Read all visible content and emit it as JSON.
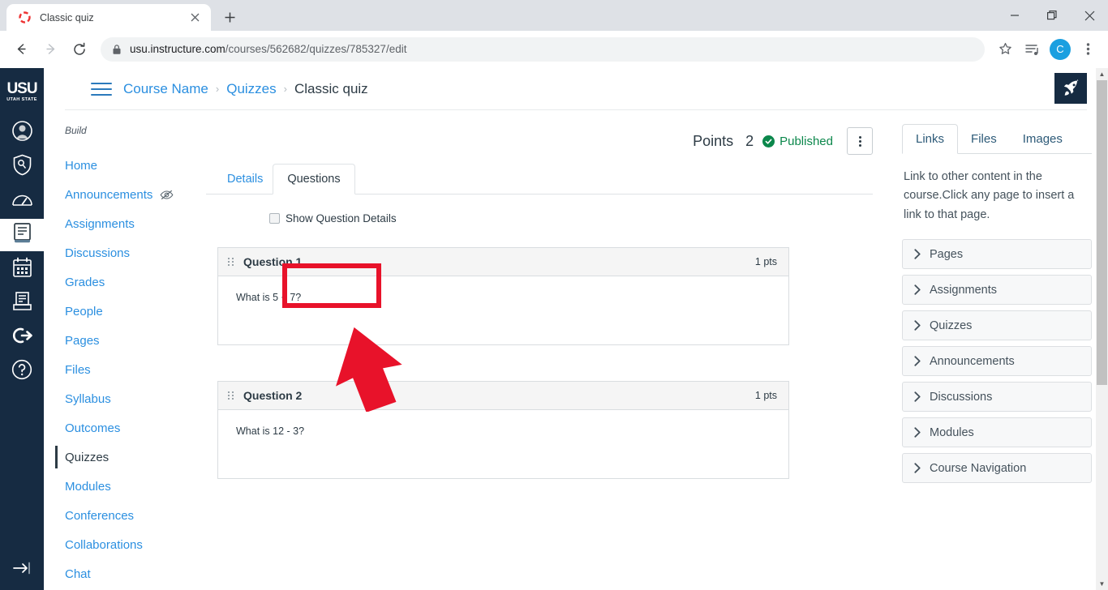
{
  "browser": {
    "tab": {
      "title": "Classic quiz",
      "favicon_icon": "loading-spinner-icon",
      "close_icon": "close-icon"
    },
    "new_tab_icon": "plus-icon",
    "window": {
      "minimize_icon": "minimize-icon",
      "maximize_icon": "restore-icon",
      "close_icon": "close-icon"
    },
    "toolbar": {
      "back_icon": "back-arrow-icon",
      "forward_icon": "forward-arrow-icon",
      "reload_icon": "reload-icon",
      "lock_icon": "lock-icon",
      "url_host": "usu.instructure.com",
      "url_path": "/courses/562682/quizzes/785327/edit",
      "bookmark_icon": "star-icon",
      "readinglist_icon": "reading-list-icon",
      "profile_initial": "C",
      "menu_icon": "kebab-menu-icon"
    }
  },
  "global_nav": {
    "logo": {
      "word": "USU",
      "sub": "UTAH STATE"
    },
    "items": [
      {
        "name": "account",
        "icon": "user-avatar-icon",
        "active": false
      },
      {
        "name": "admin",
        "icon": "shield-key-icon",
        "active": false
      },
      {
        "name": "dashboard",
        "icon": "speedometer-icon",
        "active": false
      },
      {
        "name": "courses",
        "icon": "book-icon",
        "active": true
      },
      {
        "name": "calendar",
        "icon": "calendar-icon",
        "active": false
      },
      {
        "name": "inbox",
        "icon": "inbox-tray-icon",
        "active": false
      },
      {
        "name": "logout",
        "icon": "logout-arrow-icon",
        "active": false
      },
      {
        "name": "help",
        "icon": "question-mark-icon",
        "active": false
      }
    ],
    "collapse_icon": "collapse-arrow-icon"
  },
  "breadcrumb": {
    "menu_icon": "hamburger-icon",
    "items": [
      {
        "label": "Course Name",
        "current": false
      },
      {
        "label": "Quizzes",
        "current": false
      },
      {
        "label": "Classic quiz",
        "current": true
      }
    ],
    "separator": "›"
  },
  "course_nav": {
    "section_label": "Build",
    "items": [
      {
        "label": "Home",
        "active": false,
        "hidden_icon": false
      },
      {
        "label": "Announcements",
        "active": false,
        "hidden_icon": true
      },
      {
        "label": "Assignments",
        "active": false,
        "hidden_icon": false
      },
      {
        "label": "Discussions",
        "active": false,
        "hidden_icon": false
      },
      {
        "label": "Grades",
        "active": false,
        "hidden_icon": false
      },
      {
        "label": "People",
        "active": false,
        "hidden_icon": false
      },
      {
        "label": "Pages",
        "active": false,
        "hidden_icon": false
      },
      {
        "label": "Files",
        "active": false,
        "hidden_icon": false
      },
      {
        "label": "Syllabus",
        "active": false,
        "hidden_icon": false
      },
      {
        "label": "Outcomes",
        "active": false,
        "hidden_icon": false
      },
      {
        "label": "Quizzes",
        "active": true,
        "hidden_icon": false
      },
      {
        "label": "Modules",
        "active": false,
        "hidden_icon": false
      },
      {
        "label": "Conferences",
        "active": false,
        "hidden_icon": false
      },
      {
        "label": "Collaborations",
        "active": false,
        "hidden_icon": false
      },
      {
        "label": "Chat",
        "active": false,
        "hidden_icon": false
      }
    ]
  },
  "quiz": {
    "points_label": "Points",
    "points_value": "2",
    "status_label": "Published",
    "status_icon": "check-circle-icon",
    "status_color": "#0b874b",
    "kebab_icon": "kebab-menu-icon",
    "tabs": [
      {
        "label": "Details",
        "selected": false
      },
      {
        "label": "Questions",
        "selected": true
      }
    ],
    "show_details": {
      "label": "Show Question Details",
      "checked": false
    },
    "questions": [
      {
        "title": "Question 1",
        "points": "1 pts",
        "text": "What is 5 + 7?",
        "drag_icon": "drag-handle-icon"
      },
      {
        "title": "Question 2",
        "points": "1 pts",
        "text": "What is 12 - 3?",
        "drag_icon": "drag-handle-icon"
      }
    ]
  },
  "right_sidebar": {
    "tabs": [
      {
        "label": "Links",
        "selected": true
      },
      {
        "label": "Files",
        "selected": false
      },
      {
        "label": "Images",
        "selected": false
      }
    ],
    "description": "Link to other content in the course.Click any page to insert a link to that page.",
    "accordion": [
      {
        "label": "Pages",
        "icon": "chevron-right-icon"
      },
      {
        "label": "Assignments",
        "icon": "chevron-right-icon"
      },
      {
        "label": "Quizzes",
        "icon": "chevron-right-icon"
      },
      {
        "label": "Announcements",
        "icon": "chevron-right-icon"
      },
      {
        "label": "Discussions",
        "icon": "chevron-right-icon"
      },
      {
        "label": "Modules",
        "icon": "chevron-right-icon"
      },
      {
        "label": "Course Navigation",
        "icon": "chevron-right-icon"
      }
    ]
  },
  "floating": {
    "rocket_icon": "rocket-icon"
  },
  "annotations": {
    "highlight_color": "#e8122a",
    "target": "Questions",
    "shapes": [
      "rectangle-highlight",
      "up-arrow-pointer"
    ]
  },
  "scrollbar": {
    "up_icon": "scroll-up-icon",
    "down_icon": "scroll-down-icon"
  }
}
